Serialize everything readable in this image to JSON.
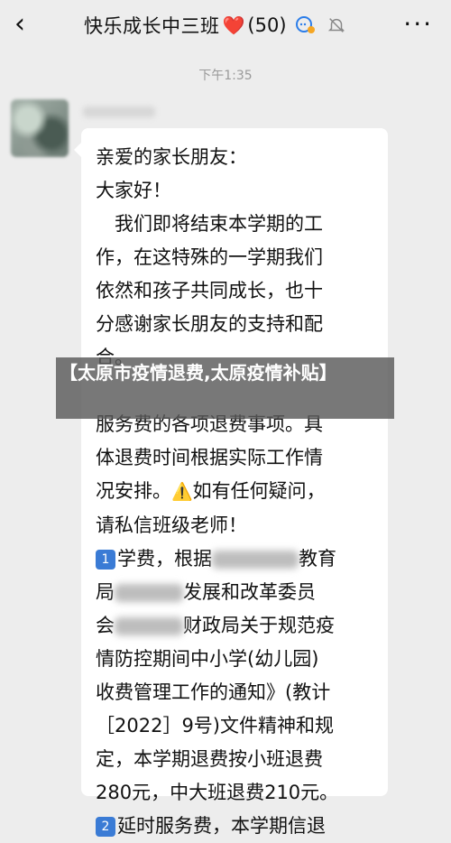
{
  "header": {
    "back_icon": "chevron-left-icon",
    "title": "快乐成长中三班",
    "heart": "❤️",
    "member_count": "(50)",
    "wecom_icon": "wecom-chat-icon",
    "mute_icon": "mute-bell-icon",
    "more_label": "···"
  },
  "chat": {
    "timestamp": "下午1:35",
    "message_lines": [
      "亲爱的家长朋友：",
      "大家好！",
      "　我们即将结束本学期的工",
      "作，在这特殊的一学期我们",
      "依然和孩子共同成长，也十",
      "分感谢家长朋友的支持和配",
      "合。",
      "",
      "服务费的各项退费事项。具",
      "体退费时间根据实际工作情",
      "况安排。",
      "如有任何疑问，",
      "请私信班级老师！",
      "学费，根据",
      "教育",
      "局",
      "发展和改革委员",
      "会",
      "财政局关于规范疫",
      "情防控期间中小学(幼儿园)",
      "收费管理工作的通知》(教计",
      "［2022］9号)文件精神和规",
      "定，本学期退费按小班退费",
      "280元，中大班退费210元。",
      "延时服务费，本学期信退"
    ],
    "badge_1": "1",
    "badge_2": "2",
    "warning_icon": "⚠️"
  },
  "overlay": {
    "text": "【太原市疫情退费,太原疫情补贴】"
  }
}
